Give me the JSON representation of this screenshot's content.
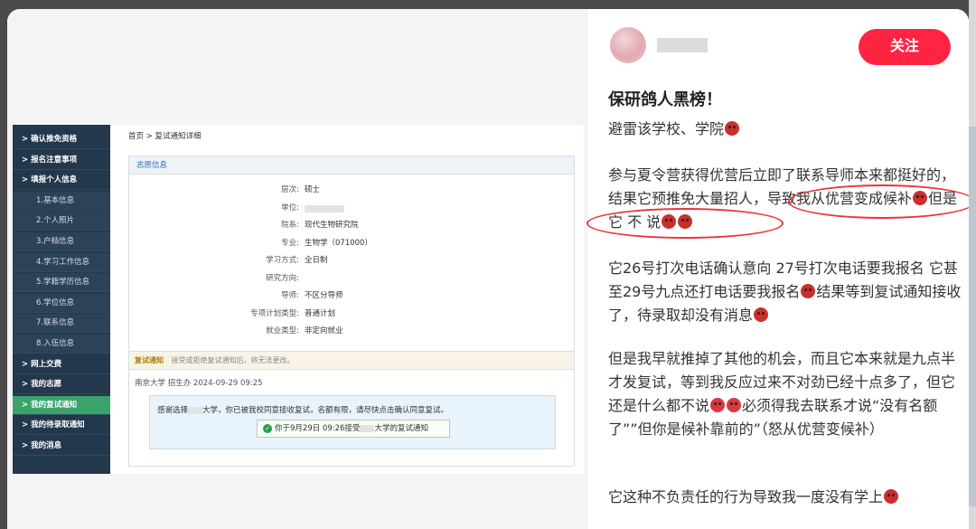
{
  "screenshot": {
    "breadcrumb": "首页 > 复试通知详细",
    "sidebar": [
      {
        "label": "> 确认推免资格",
        "kind": "main"
      },
      {
        "label": "> 报名注意事项",
        "kind": "main"
      },
      {
        "label": "> 填报个人信息",
        "kind": "main"
      },
      {
        "label": "1.基本信息",
        "kind": "sub"
      },
      {
        "label": "2.个人照片",
        "kind": "sub"
      },
      {
        "label": "3.户档信息",
        "kind": "sub"
      },
      {
        "label": "4.学习工作信息",
        "kind": "sub"
      },
      {
        "label": "5.学籍学历信息",
        "kind": "sub"
      },
      {
        "label": "6.学位信息",
        "kind": "sub"
      },
      {
        "label": "7.联系信息",
        "kind": "sub"
      },
      {
        "label": "8.入伍信息",
        "kind": "sub"
      },
      {
        "label": "> 网上交费",
        "kind": "main"
      },
      {
        "label": "> 我的志愿",
        "kind": "main"
      },
      {
        "label": "> 我的复试通知",
        "kind": "active"
      },
      {
        "label": "> 我的待录取通知",
        "kind": "main"
      },
      {
        "label": "> 我的消息",
        "kind": "main"
      }
    ],
    "volunteer_panel": {
      "title": "志愿信息",
      "fields": [
        {
          "k": "层次:",
          "v": "硕士"
        },
        {
          "k": "单位:",
          "v": ""
        },
        {
          "k": "院系:",
          "v": "现代生物研究院"
        },
        {
          "k": "专业:",
          "v": "生物学（071000）"
        },
        {
          "k": "学习方式:",
          "v": "全日制"
        },
        {
          "k": "研究方向:",
          "v": ""
        },
        {
          "k": "导师:",
          "v": "不区分导师"
        },
        {
          "k": "专项计划类型:",
          "v": "普通计划"
        },
        {
          "k": "就业类型:",
          "v": "非定向就业"
        }
      ]
    },
    "retest_panel": {
      "title": "复试通知",
      "desc": "接受或拒绝复试通知后，将无法更改。",
      "sender": "南京大学 招生办 2024-09-29 09:25",
      "notice_a": "感谢选择",
      "notice_b": "大学，你已被我校同意接收复试，名额有限，请尽快点击确认同意复试。",
      "button_a": "你于9月29日 09:26接受",
      "button_b": "大学的复试通知"
    }
  },
  "post": {
    "follow_label": "关注",
    "title": "保研鸽人黑榜！",
    "p1": "避雷该学校、学院",
    "p2a": "参与夏令营获得优营后立即了联系导师本来都挺好的，结果它预推免大量招人，导致我从优营变成候补",
    "p2b": "但是 它 不 说",
    "p3a": "它26号打次电话确认意向 27号打次电话要我报名 它甚至29号九点还打电话要我报名",
    "p3b": "结果等到复试通知接收了，待录取却没有消息",
    "p4a": "但是我早就推掉了其他的机会，而且它本来就是九点半才发复试，等到我反应过来不对劲已经十点多了，但它还是什么都不说",
    "p4b": "必须得我去联系才说“没有名额了””但你是候补靠前的”（怒从优营变候补）",
    "p5": "它这种不负责任的行为导致我一度没有学上"
  }
}
